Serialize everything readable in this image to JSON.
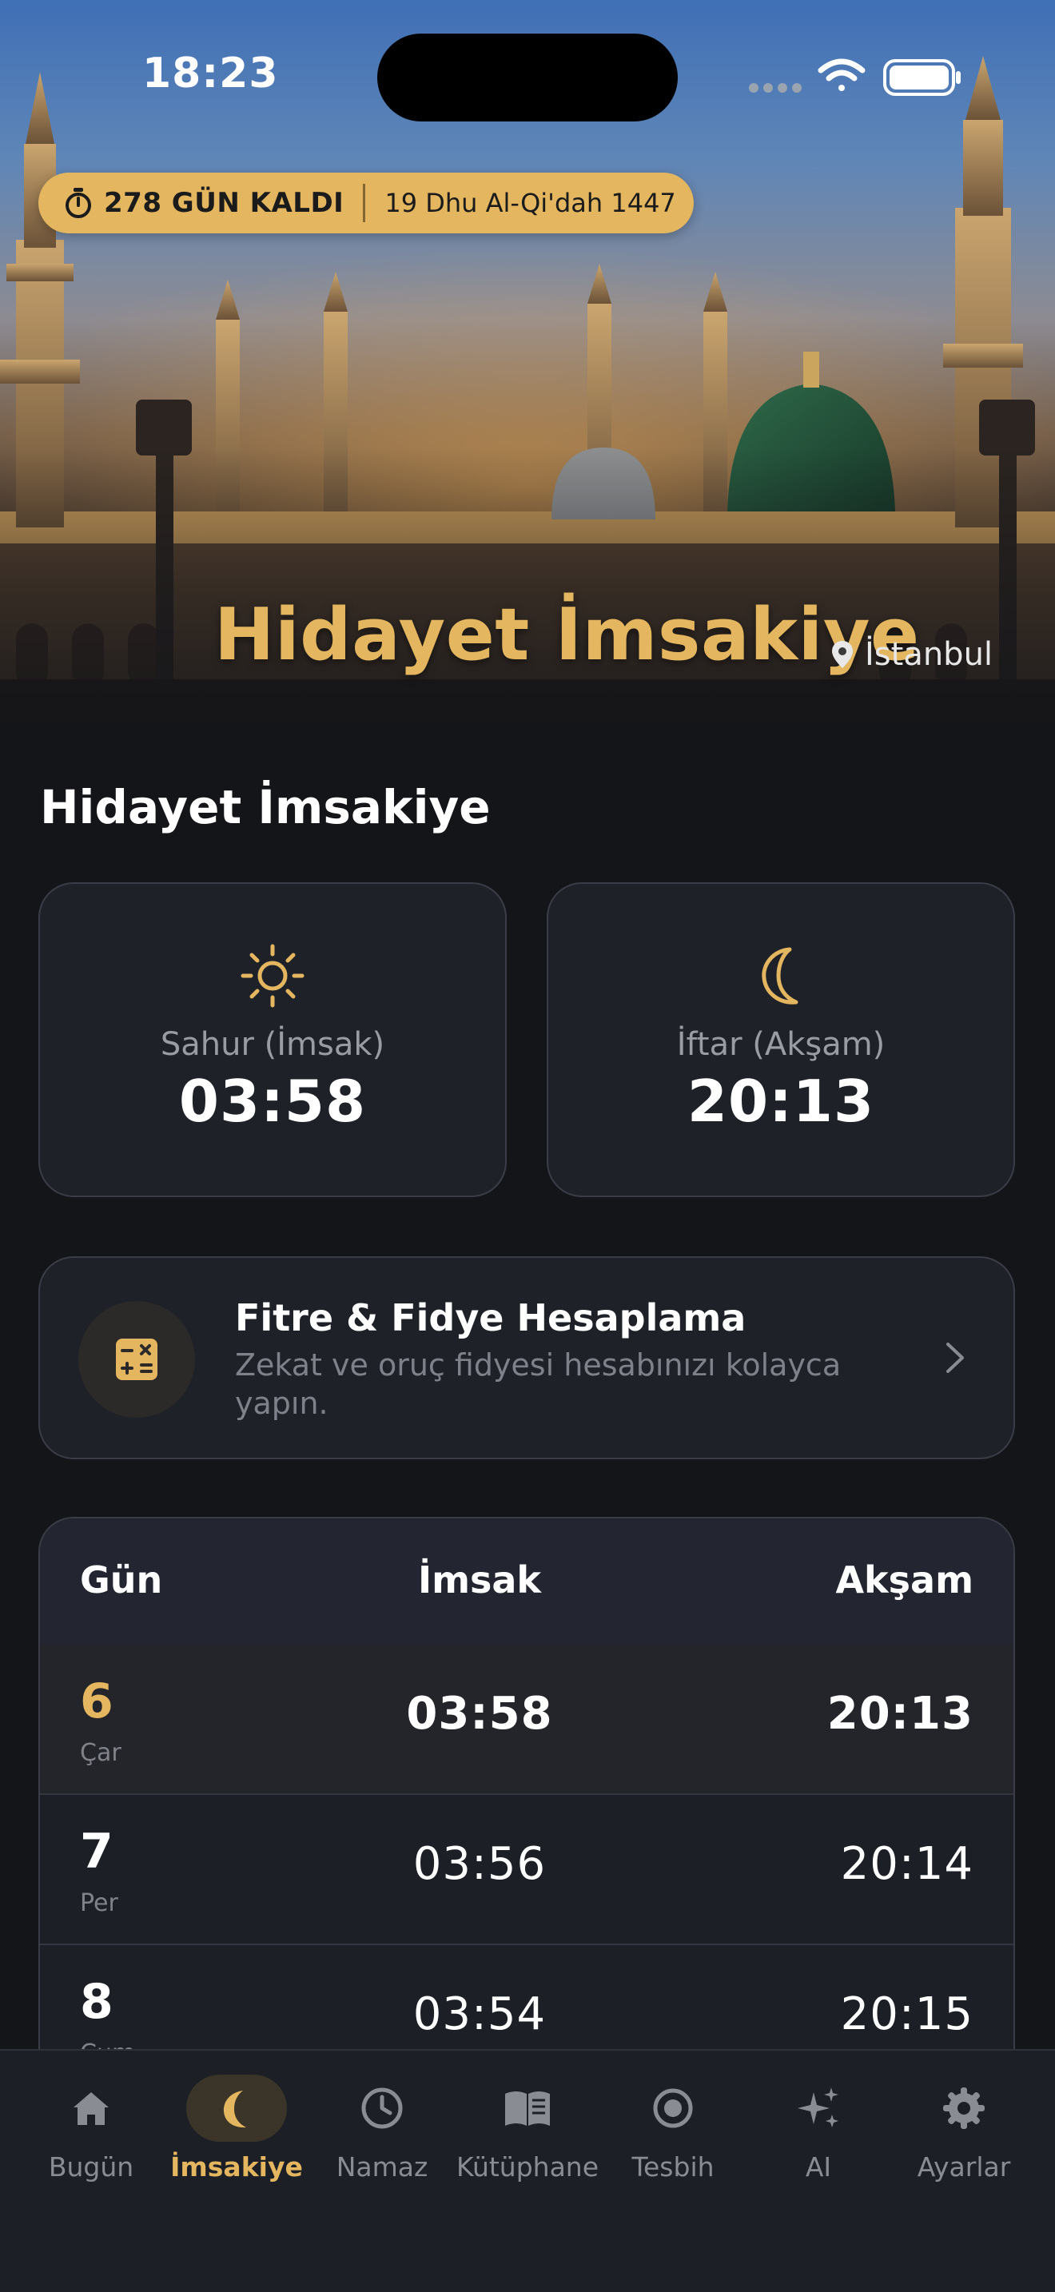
{
  "status_bar": {
    "time": "18:23"
  },
  "hero": {
    "countdown_days": "278 GÜN KALDI",
    "hijri_date": "19 Dhu Al-Qi'dah 1447",
    "title": "Hidayet İmsakiye",
    "city": "İstanbul"
  },
  "section": {
    "title": "Hidayet İmsakiye"
  },
  "cards": {
    "sahur": {
      "label": "Sahur (İmsak)",
      "time": "03:58",
      "icon": "sun-icon"
    },
    "iftar": {
      "label": "İftar (Akşam)",
      "time": "20:13",
      "icon": "moon-icon"
    }
  },
  "fitre": {
    "title": "Fitre & Fidye Hesaplama",
    "subtitle": "Zekat ve oruç fidyesi hesabınızı kolayca yapın."
  },
  "table": {
    "headers": {
      "day": "Gün",
      "imsak": "İmsak",
      "aksam": "Akşam"
    },
    "rows": [
      {
        "day": "6",
        "weekday": "Çar",
        "imsak": "03:58",
        "aksam": "20:13"
      },
      {
        "day": "7",
        "weekday": "Per",
        "imsak": "03:56",
        "aksam": "20:14"
      },
      {
        "day": "8",
        "weekday": "Cum",
        "imsak": "03:54",
        "aksam": "20:15"
      }
    ]
  },
  "tabbar": {
    "active_color": "#e3b65f",
    "items": [
      {
        "label": "Bugün",
        "icon": "home-icon"
      },
      {
        "label": "İmsakiye",
        "icon": "moon-icon"
      },
      {
        "label": "Namaz",
        "icon": "clock-icon"
      },
      {
        "label": "Kütüphane",
        "icon": "book-icon"
      },
      {
        "label": "Tesbih",
        "icon": "target-icon"
      },
      {
        "label": "AI",
        "icon": "sparkles-icon"
      },
      {
        "label": "Ayarlar",
        "icon": "gear-icon"
      }
    ]
  },
  "colors": {
    "accent": "#e3b65f",
    "background": "#141519",
    "card": "#1f2129"
  }
}
